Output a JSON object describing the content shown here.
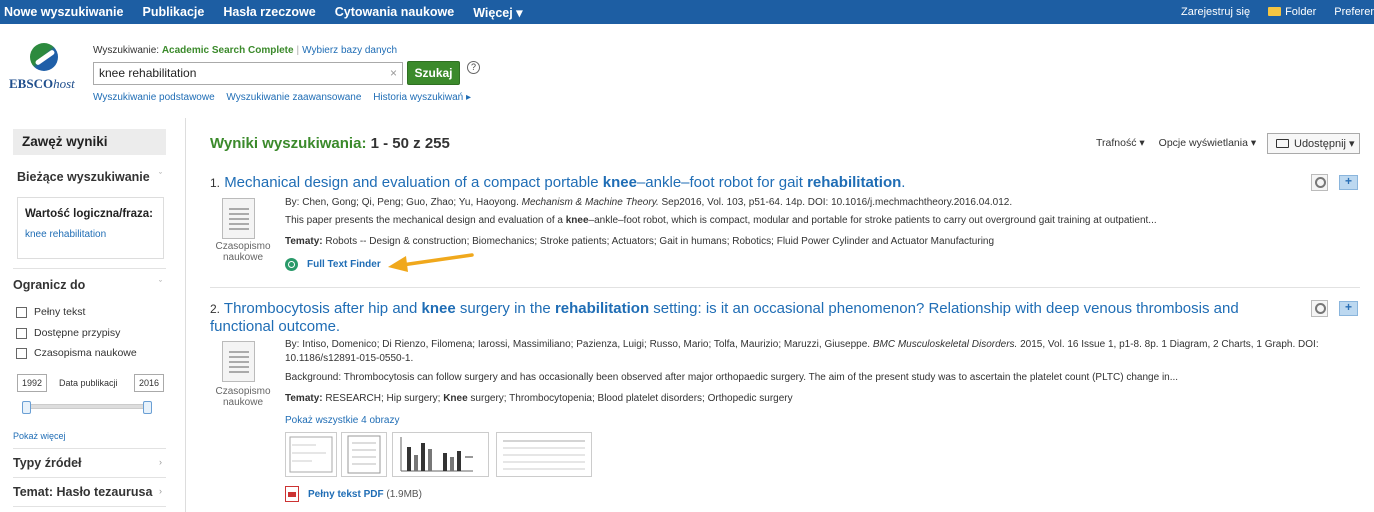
{
  "topnav": {
    "items": [
      "Nowe wyszukiwanie",
      "Publikacje",
      "Hasła rzeczowe",
      "Cytowania naukowe",
      "Więcej ▾"
    ],
    "register": "Zarejestruj się",
    "folder": "Folder",
    "preferences": "Preferencje"
  },
  "logo": {
    "brand": "EBSCO",
    "suffix": "host"
  },
  "search": {
    "label": "Wyszukiwanie:",
    "database": "Academic Search Complete",
    "choose_db": "Wybierz bazy danych",
    "query": "knee rehabilitation",
    "clear": "×",
    "button": "Szukaj",
    "help": "?",
    "links": [
      "Wyszukiwanie podstawowe",
      "Wyszukiwanie zaawansowane",
      "Historia wyszukiwań ▸"
    ]
  },
  "sidebar": {
    "narrow": "Zawęż wyniki",
    "current": "Bieżące wyszukiwanie",
    "bool_label": "Wartość logiczna/fraza:",
    "bool_value": "knee rehabilitation",
    "limit": "Ogranicz do",
    "checks": [
      "Pełny tekst",
      "Dostępne przypisy",
      "Czasopisma naukowe"
    ],
    "year_from": "1992",
    "year_label": "Data publikacji",
    "year_to": "2016",
    "show_more": "Pokaż więcej",
    "source_types": "Typy źródeł",
    "subject": "Temat: Hasło tezaurusa"
  },
  "results": {
    "title": "Wyniki wyszukiwania:",
    "range": "1 - 50 z 255",
    "sort": "Trafność ▾",
    "display": "Opcje wyświetlania ▾",
    "share": "Udostępnij ▾",
    "items": [
      {
        "num": "1.",
        "title_parts": [
          "Mechanical design and evaluation of a compact portable ",
          "knee",
          "–ankle–foot robot for gait ",
          "rehabilitation",
          "."
        ],
        "doc_type": "Czasopismo naukowe",
        "authors": "By: Chen, Gong; Qi, Peng; Guo, Zhao; Yu, Haoyong.",
        "journal": "Mechanism & Machine Theory.",
        "details": "Sep2016, Vol. 103, p51-64. 14p. DOI: 10.1016/j.mechmachtheory.2016.04.012.",
        "abstract_pre": "This paper presents the mechanical design and evaluation of a ",
        "abstract_bold": "knee",
        "abstract_post": "–ankle–foot robot, which is compact, modular and portable for stroke patients to carry out overground gait training at outpatient...",
        "subjects_label": "Tematy:",
        "subjects": "Robots -- Design & construction; Biomechanics; Stroke patients; Actuators; Gait in humans; Robotics; Fluid Power Cylinder and Actuator Manufacturing",
        "link": "Full Text Finder"
      },
      {
        "num": "2.",
        "title_parts": [
          "Thrombocytosis after hip and ",
          "knee",
          " surgery in the ",
          "rehabilitation",
          " setting: is it an occasional phenomenon? Relationship with deep venous thrombosis and functional outcome."
        ],
        "doc_type": "Czasopismo naukowe",
        "authors": "By: Intiso, Domenico; Di Rienzo, Filomena; Iarossi, Massimiliano; Pazienza, Luigi; Russo, Mario; Tolfa, Maurizio; Maruzzi, Giuseppe.",
        "journal": "BMC Musculoskeletal Disorders.",
        "details": "2015, Vol. 16 Issue 1, p1-8. 8p. 1 Diagram, 2 Charts, 1 Graph. DOI: 10.1186/s12891-015-0550-1.",
        "abstract": "Background: Thrombocytosis can follow surgery and has occasionally been observed after major orthopaedic surgery. The aim of the present study was to ascertain the platelet count (PLTC) change in...",
        "subjects_label": "Tematy:",
        "subjects_pre": "RESEARCH; Hip surgery; ",
        "subjects_bold": "Knee",
        "subjects_post": " surgery; Thrombocytopenia; Blood platelet disorders; Orthopedic surgery",
        "images_link": "Pokaż wszystkie 4 obrazy",
        "pdf_link": "Pełny tekst PDF",
        "pdf_size": "(1.9MB)"
      }
    ]
  },
  "colors": {
    "nav": "#1d5ea3",
    "green": "#3b8a2b",
    "link": "#1f6db5",
    "arrow": "#f0a81c"
  }
}
